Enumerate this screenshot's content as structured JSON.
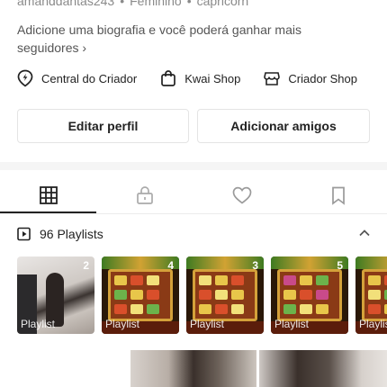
{
  "profile": {
    "username": "amanddantas243",
    "gender": "Feminino",
    "sign": "capricorn",
    "bio_prompt": "Adicione uma biografia e você poderá ganhar mais seguidores",
    "bio_chevron": "›"
  },
  "links": [
    {
      "label": "Central do Criador",
      "icon": "bulb-pin-icon"
    },
    {
      "label": "Kwai Shop",
      "icon": "shopping-bag-icon"
    },
    {
      "label": "Criador Shop",
      "icon": "shop-store-icon"
    }
  ],
  "buttons": {
    "edit_profile": "Editar perfil",
    "add_friends": "Adicionar amigos"
  },
  "tabs": [
    {
      "name": "grid",
      "icon": "grid-icon",
      "active": true
    },
    {
      "name": "private",
      "icon": "lock-icon",
      "active": false
    },
    {
      "name": "liked",
      "icon": "heart-icon",
      "active": false
    },
    {
      "name": "saved",
      "icon": "bookmark-icon",
      "active": false
    }
  ],
  "playlists": {
    "header": "96 Playlists",
    "items": [
      {
        "count": "2",
        "tag": "Playlist"
      },
      {
        "count": "4",
        "tag": "Playlist"
      },
      {
        "count": "3",
        "tag": "Playlist"
      },
      {
        "count": "5",
        "tag": "Playlist"
      },
      {
        "count": "",
        "tag": "Playlis"
      }
    ]
  },
  "colors": {
    "text": "#222222",
    "muted": "#8a8a8a",
    "separator": "#f5f5f5",
    "border": "#e4e4e4"
  }
}
